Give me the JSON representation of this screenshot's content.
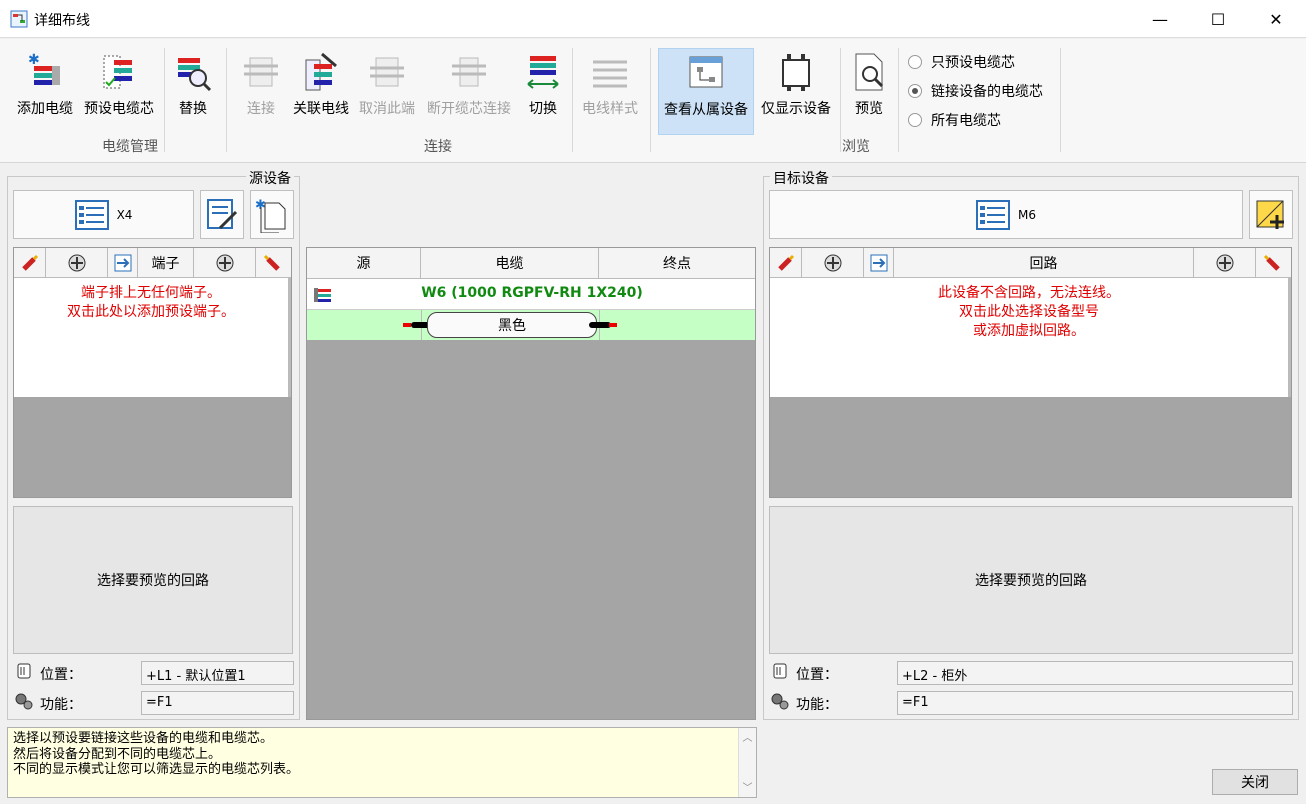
{
  "window": {
    "title": "详细布线",
    "minimize": "—",
    "maximize": "☐",
    "close": "✕"
  },
  "ribbon": {
    "buttons": [
      {
        "label": "添加电缆",
        "icon": "add-cable-icon",
        "enabled": true
      },
      {
        "label": "预设电缆芯",
        "icon": "preset-cores-icon",
        "enabled": true
      },
      {
        "label": "替换",
        "icon": "replace-icon",
        "enabled": true
      },
      {
        "label": "连接",
        "icon": "connect-icon",
        "enabled": false
      },
      {
        "label": "关联电线",
        "icon": "associate-wire-icon",
        "enabled": true
      },
      {
        "label": "取消此端",
        "icon": "cancel-end-icon",
        "enabled": false
      },
      {
        "label": "断开缆芯连接",
        "icon": "disconnect-core-icon",
        "enabled": false
      },
      {
        "label": "切换",
        "icon": "swap-icon",
        "enabled": true
      },
      {
        "label": "电线样式",
        "icon": "wire-style-icon",
        "enabled": false
      },
      {
        "label": "查看从属设备",
        "icon": "view-subordinate-icon",
        "enabled": true,
        "active": true
      },
      {
        "label": "仅显示设备",
        "icon": "device-only-icon",
        "enabled": true
      },
      {
        "label": "预览",
        "icon": "preview-icon",
        "enabled": true
      }
    ],
    "groups": [
      "电缆管理",
      "连接",
      "浏览"
    ],
    "radio_options": [
      {
        "label": "只预设电缆芯",
        "checked": false
      },
      {
        "label": "链接设备的电缆芯",
        "checked": true
      },
      {
        "label": "所有电缆芯",
        "checked": false
      }
    ]
  },
  "source": {
    "section_title": "源设备",
    "device_name": "X4",
    "header_label": "端子",
    "empty_line1": "端子排上无任何端子。",
    "empty_line2": "双击此处以添加预设端子。",
    "preview_text": "选择要预览的回路",
    "location_label": "位置：",
    "location_value": "+L1 - 默认位置1",
    "function_label": "功能：",
    "function_value": "=F1"
  },
  "cable": {
    "col_source": "源",
    "col_cable": "电缆",
    "col_end": "终点",
    "cable_name": "W6 (1000 RGPFV-RH 1X240)",
    "core_color": "黑色",
    "accent_green": "#118a11",
    "row_bg": "#c6ffc6"
  },
  "target": {
    "section_title": "目标设备",
    "device_name": "M6",
    "header_label": "回路",
    "empty_line1": "此设备不含回路，无法连线。",
    "empty_line2": "双击此处选择设备型号",
    "empty_line3": "或添加虚拟回路。",
    "preview_text": "选择要预览的回路",
    "location_label": "位置：",
    "location_value": "+L2 - 柜外",
    "function_label": "功能：",
    "function_value": "=F1"
  },
  "hint": {
    "line1": "选择以预设要链接这些设备的电缆和电缆芯。",
    "line2": "然后将设备分配到不同的电缆芯上。",
    "line3": "不同的显示模式让您可以筛选显示的电缆芯列表。"
  },
  "footer": {
    "close_button": "关闭"
  }
}
